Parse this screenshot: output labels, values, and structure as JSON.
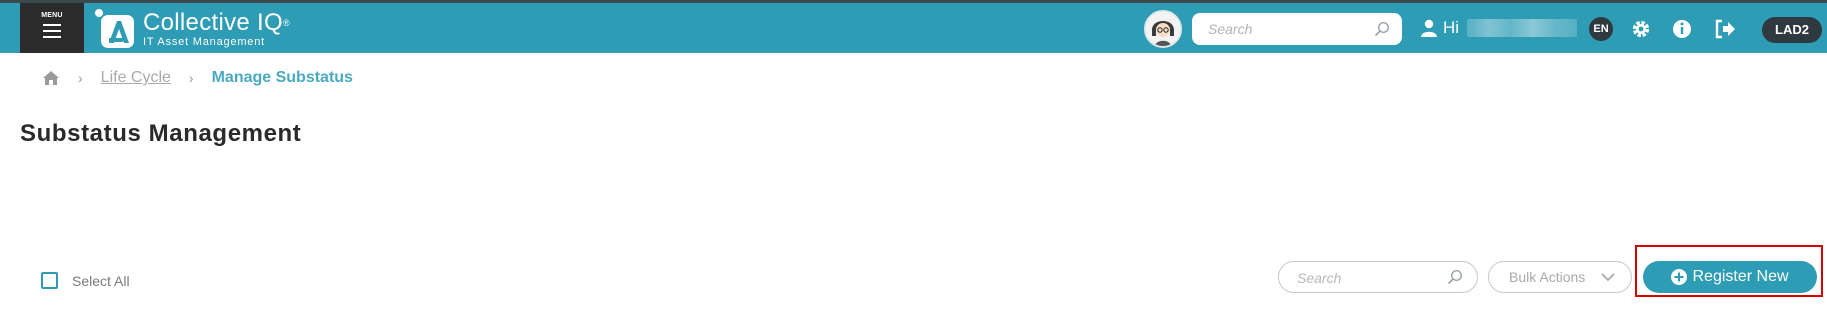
{
  "header": {
    "menu_label": "MENU",
    "app_name": "Collective IQ",
    "registered_mark": "®",
    "app_subtitle": "IT Asset Management",
    "search_placeholder": "Search",
    "greeting": "Hi",
    "language": "EN",
    "tenant_badge": "LAD2",
    "icons": [
      "menu-icon",
      "logo-icon",
      "avatar-icon",
      "search-icon",
      "user-icon",
      "gear-icon",
      "info-icon",
      "logout-icon"
    ]
  },
  "breadcrumb": {
    "home_icon": "home-icon",
    "items": [
      {
        "label": "Life Cycle"
      },
      {
        "label": "Manage Substatus"
      }
    ]
  },
  "page": {
    "title": "Substatus Management"
  },
  "toolbar": {
    "select_all_label": "Select All",
    "search_placeholder": "Search",
    "bulk_actions_label": "Bulk Actions",
    "register_label": "Register New"
  },
  "colors": {
    "header_bg": "#2e9cb5",
    "accent": "#2e9cb5",
    "dark_badge": "#2f3a40",
    "highlight_border": "#d80000"
  }
}
